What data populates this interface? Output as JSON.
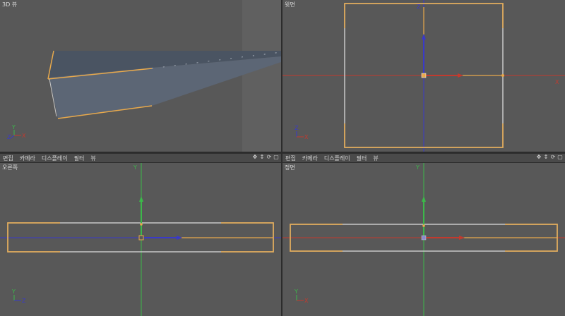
{
  "viewports": {
    "perspective": {
      "label": "3D 뷰"
    },
    "top": {
      "label": "윗면",
      "axis_x": "X",
      "axis_z": "Z"
    },
    "right": {
      "label": "오른쪽",
      "axis_y": "Y"
    },
    "front": {
      "label": "정면",
      "axis_y": "Y"
    }
  },
  "menu": {
    "items": [
      "편집",
      "카메라",
      "디스플레이",
      "필터",
      "뷰"
    ]
  },
  "gizmo": {
    "perspective": {
      "y": "Y",
      "x": "X",
      "z": "Z"
    },
    "top": {
      "z": "Z",
      "x": "X"
    },
    "right": {
      "y": "Y",
      "z": "Z"
    },
    "front": {
      "y": "Y",
      "x": "X"
    }
  },
  "icons": [
    "move-icon",
    "pan-icon",
    "rotate-icon",
    "maximize-icon"
  ],
  "colors": {
    "viewport_bg": "#585858",
    "selection_orange": "#e8a94c",
    "axis_red": "#c23a2e",
    "axis_green": "#3cb84a",
    "axis_blue": "#3a3ac8",
    "edge_white": "#c8c8c8"
  }
}
